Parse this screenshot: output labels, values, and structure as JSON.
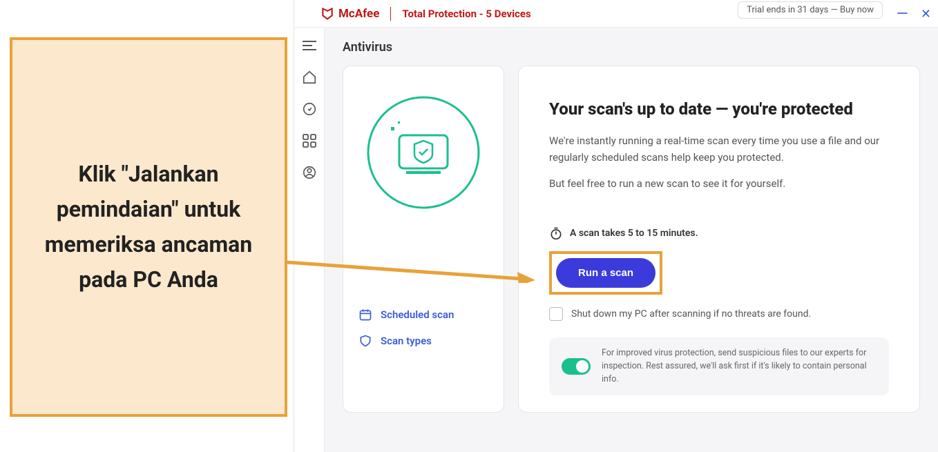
{
  "callout": {
    "text": "Klik \"Jalankan pemindaian\" untuk memeriksa ancaman pada PC Anda"
  },
  "titlebar": {
    "brand": "McAfee",
    "product": "Total Protection - 5 Devices",
    "trial": "Trial ends in 31 days — Buy now"
  },
  "page": {
    "title": "Antivirus"
  },
  "left_card": {
    "scheduled_scan": "Scheduled scan",
    "scan_types": "Scan types"
  },
  "right_card": {
    "headline": "Your scan's up to date — you're protected",
    "body1": "We're instantly running a real-time scan every time you use a file and our regularly scheduled scans help keep you protected.",
    "body2": "But feel free to run a new scan to see it for yourself.",
    "duration": "A scan takes 5 to 15 minutes.",
    "run_button": "Run a scan",
    "shutdown": "Shut down my PC after scanning if no threats are found.",
    "footer": "For improved virus protection, send suspicious files to our experts for inspection. Rest assured, we'll ask first if it's likely to contain personal info."
  }
}
